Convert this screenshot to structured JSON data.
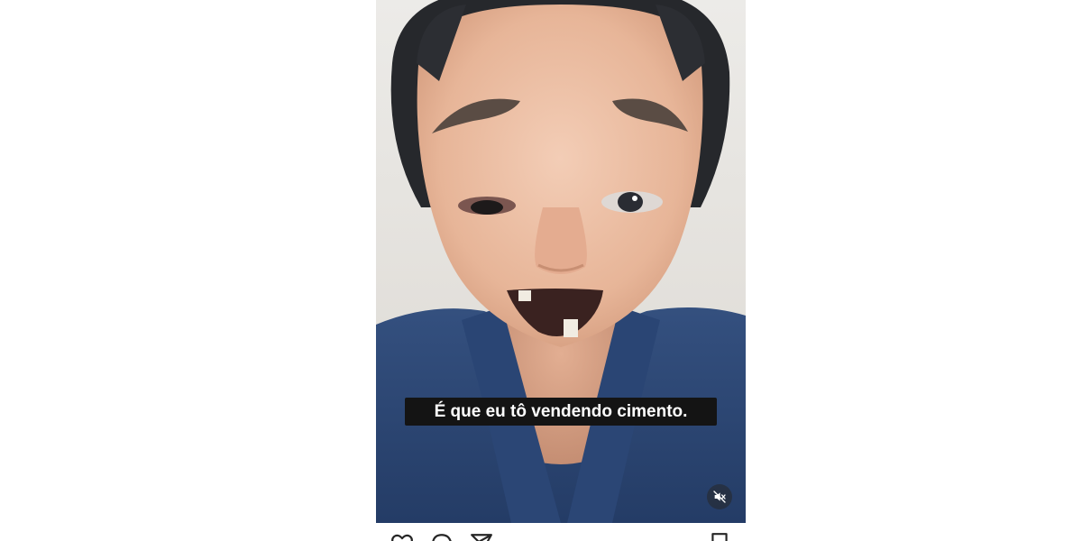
{
  "video": {
    "caption": "É que eu tô vendendo cimento.",
    "muted": true,
    "icons": {
      "mute": "speaker-muted-icon"
    }
  },
  "actions": {
    "icons": [
      "heart-icon",
      "comment-icon",
      "share-icon",
      "bookmark-icon"
    ]
  },
  "colors": {
    "caption_bg": "#141414",
    "caption_text": "#ffffff",
    "shirt": "#2d4876",
    "background": "#ffffff"
  }
}
